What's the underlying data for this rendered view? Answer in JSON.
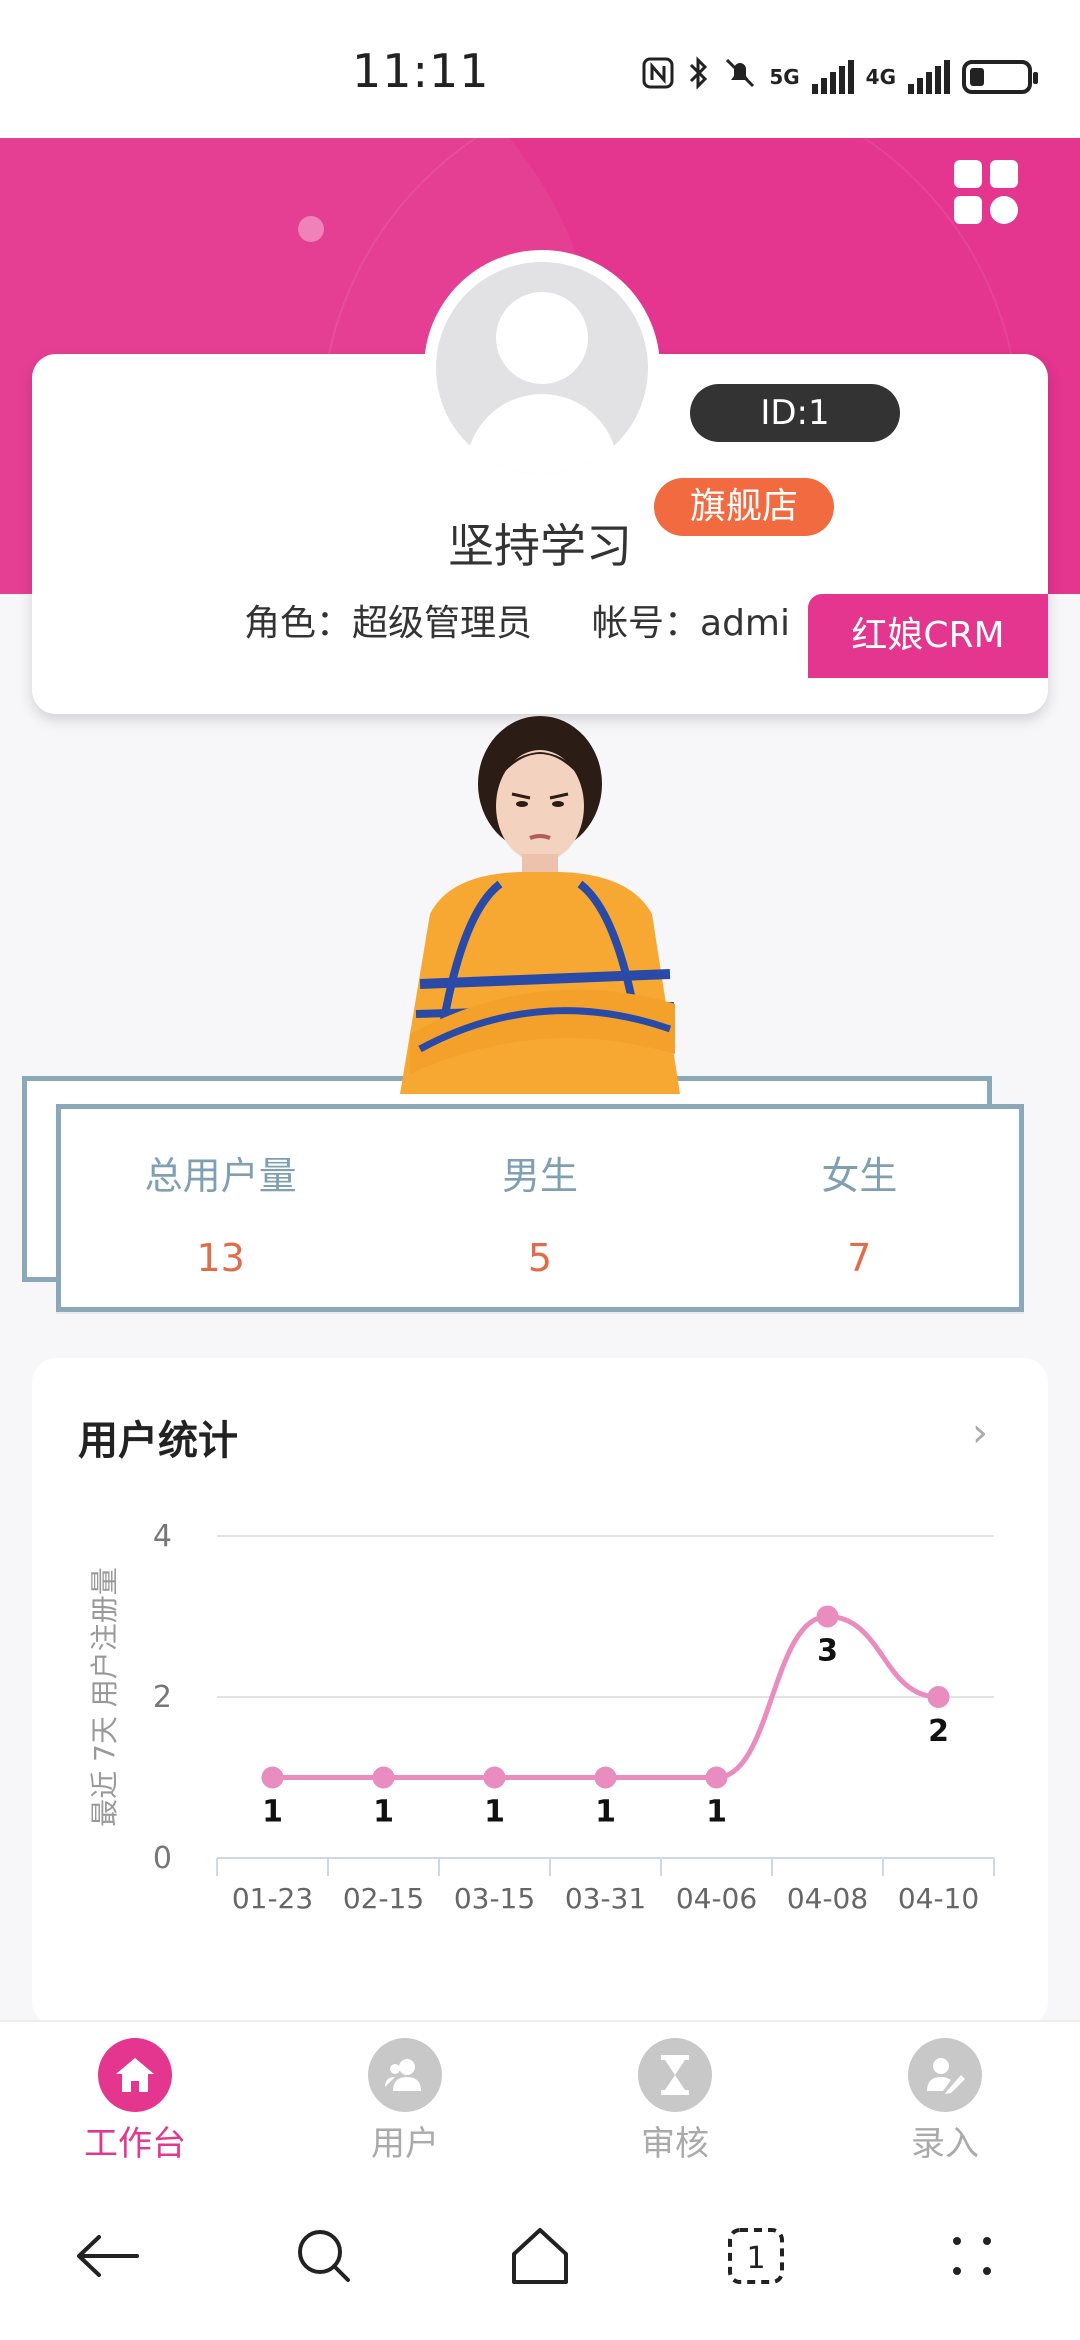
{
  "status_bar": {
    "time": "11:11",
    "net1": "5G",
    "net2": "4G"
  },
  "profile": {
    "id_label": "ID:1",
    "store_badge": "旗舰店",
    "username": "坚持学习",
    "role": "角色：超级管理员",
    "account": "帐号：admi",
    "crm_tag": "红娘CRM"
  },
  "stats": [
    {
      "label": "总用户量",
      "value": "13"
    },
    {
      "label": "男生",
      "value": "5"
    },
    {
      "label": "女生",
      "value": "7"
    }
  ],
  "chart_section": {
    "title": "用户统计"
  },
  "chart_data": {
    "type": "line",
    "ylabel": "最近 7天 用户注册量",
    "xlabel": "",
    "categories": [
      "01-23",
      "02-15",
      "03-15",
      "03-31",
      "04-06",
      "04-08",
      "04-10"
    ],
    "series": [
      {
        "values": [
          1,
          1,
          1,
          1,
          1,
          3,
          2
        ]
      }
    ],
    "ylim": [
      0,
      4
    ],
    "yticks": [
      "0",
      "2",
      "4"
    ],
    "grid": true,
    "color": "#e98cbf"
  },
  "tabs": [
    {
      "label": "工作台",
      "icon": "home-icon",
      "active": true
    },
    {
      "label": "用户",
      "icon": "users-icon",
      "active": false
    },
    {
      "label": "审核",
      "icon": "hourglass-icon",
      "active": false
    },
    {
      "label": "录入",
      "icon": "pen-user-icon",
      "active": false
    }
  ],
  "colors": {
    "brand": "#e4358f",
    "accent": "#f26a3f",
    "stat_label": "#7fa0b3",
    "stat_value": "#e06c4c"
  }
}
